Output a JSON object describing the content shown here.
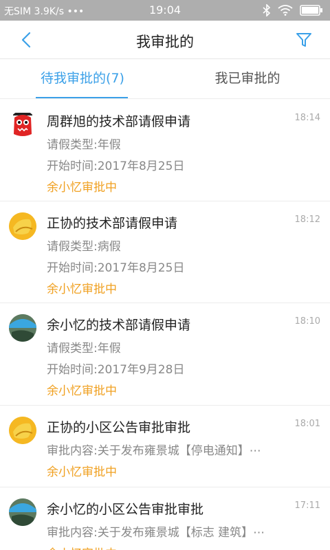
{
  "statusbar": {
    "carrier": "无SIM 3.9K/s •••",
    "time": "19:04"
  },
  "navbar": {
    "title": "我审批的"
  },
  "tabs": [
    {
      "label": "待我审批的(7)",
      "active": true
    },
    {
      "label": "我已审批的",
      "active": false
    }
  ],
  "items": [
    {
      "title": "周群旭的技术部请假申请",
      "time": "18:14",
      "lines": [
        "请假类型:年假",
        "开始时间:2017年8月25日"
      ],
      "status": "余小忆审批中",
      "avatar": "red-monster-avatar"
    },
    {
      "title": "正协的技术部请假申请",
      "time": "18:12",
      "lines": [
        "请假类型:病假",
        "开始时间:2017年8月25日"
      ],
      "status": "余小忆审批中",
      "avatar": "yellow-avatar"
    },
    {
      "title": "余小忆的技术部请假申请",
      "time": "18:10",
      "lines": [
        "请假类型:年假",
        "开始时间:2017年9月28日"
      ],
      "status": "余小忆审批中",
      "avatar": "blue-umbrella-avatar"
    },
    {
      "title": "正协的小区公告审批审批",
      "time": "18:01",
      "lines": [
        "审批内容:关于发布雍景城【停电通知】⋯"
      ],
      "status": "余小忆审批中",
      "avatar": "yellow-avatar"
    },
    {
      "title": "余小忆的小区公告审批审批",
      "time": "17:11",
      "lines": [
        "审批内容:关于发布雍景城【标志 建筑】⋯"
      ],
      "status": "余小忆审批中",
      "avatar": "blue-umbrella-avatar"
    }
  ],
  "colors": {
    "accent": "#3aa0e8",
    "status": "#f0a020",
    "statusbar_bg": "#aeaeae"
  }
}
